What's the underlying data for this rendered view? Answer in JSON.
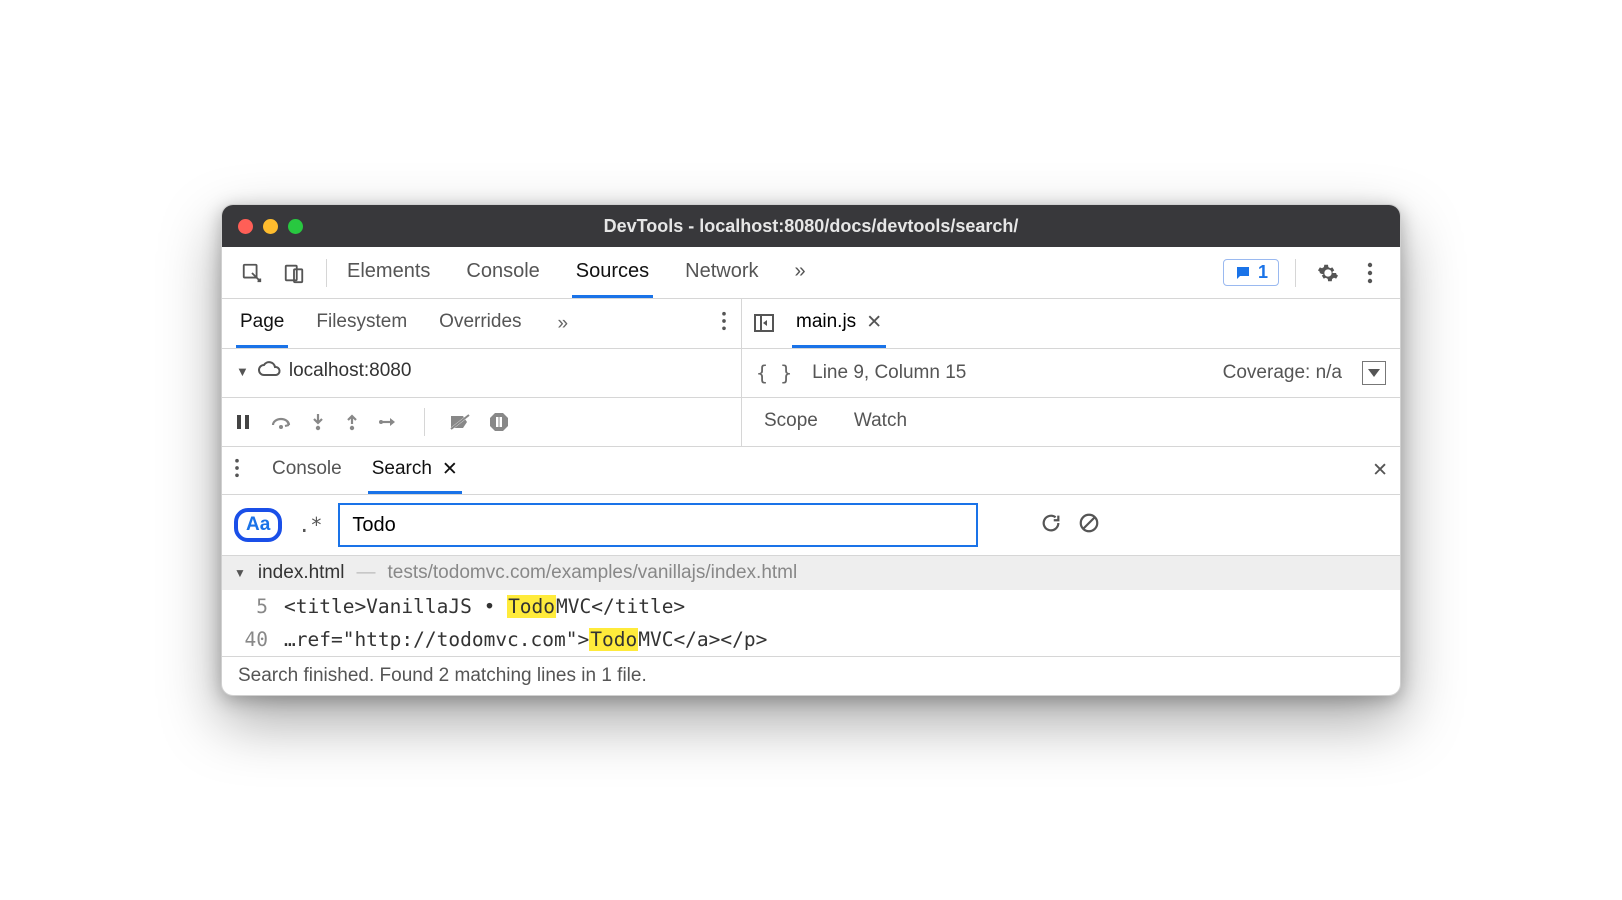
{
  "window": {
    "title": "DevTools - localhost:8080/docs/devtools/search/"
  },
  "toolbar": {
    "tabs": [
      "Elements",
      "Console",
      "Sources",
      "Network"
    ],
    "active_tab": "Sources",
    "feedback_count": "1"
  },
  "sources": {
    "sub_tabs": [
      "Page",
      "Filesystem",
      "Overrides"
    ],
    "active_sub_tab": "Page",
    "tree_root": "localhost:8080"
  },
  "editor": {
    "open_file": "main.js",
    "cursor": "Line 9, Column 15",
    "coverage": "Coverage: n/a",
    "panels": [
      "Scope",
      "Watch"
    ]
  },
  "drawer": {
    "tabs": [
      "Console",
      "Search"
    ],
    "active_tab": "Search"
  },
  "search": {
    "case_label": "Aa",
    "regex_label": ".*",
    "query": "Todo",
    "results": [
      {
        "file": "index.html",
        "path": "tests/todomvc.com/examples/vanillajs/index.html",
        "matches": [
          {
            "line": "5",
            "pre": "<title>VanillaJS • ",
            "hit": "Todo",
            "post": "MVC</title>"
          },
          {
            "line": "40",
            "pre": "…ref=\"http://todomvc.com\">",
            "hit": "Todo",
            "post": "MVC</a></p>"
          }
        ]
      }
    ],
    "status": "Search finished.  Found 2 matching lines in 1 file."
  }
}
